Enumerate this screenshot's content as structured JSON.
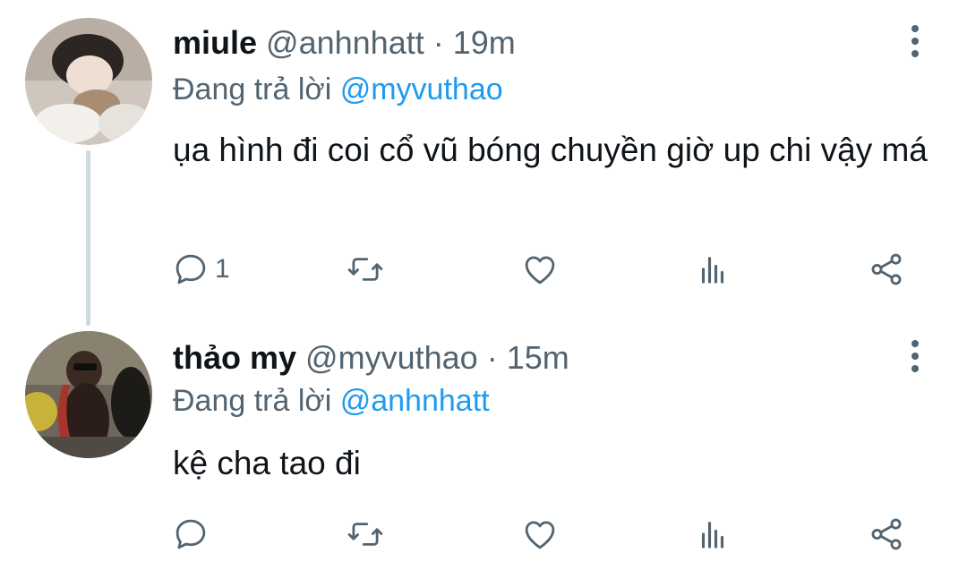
{
  "colors": {
    "text": "#0f1419",
    "muted": "#536471",
    "mention": "#1d9bf0",
    "thread_line": "#cfd9de"
  },
  "tweets": [
    {
      "name": "miule",
      "handle": "@anhnhatt",
      "separator": "·",
      "time": "19m",
      "reply_prefix": "Đang trả lời",
      "reply_to": "@myvuthao",
      "text": "ụa hình đi coi cổ vũ bóng chuyền giờ up chi vậy má",
      "reply_count": "1",
      "avatar_icon": "user-avatar-photo",
      "actions": [
        "reply-icon",
        "retweet-icon",
        "like-icon",
        "views-icon",
        "share-icon"
      ]
    },
    {
      "name": "thảo my",
      "handle": "@myvuthao",
      "separator": "·",
      "time": "15m",
      "reply_prefix": "Đang trả lời",
      "reply_to": "@anhnhatt",
      "text": "kệ cha tao đi",
      "reply_count": "",
      "avatar_icon": "user-avatar-photo",
      "actions": [
        "reply-icon",
        "retweet-icon",
        "like-icon",
        "views-icon",
        "share-icon"
      ]
    }
  ]
}
